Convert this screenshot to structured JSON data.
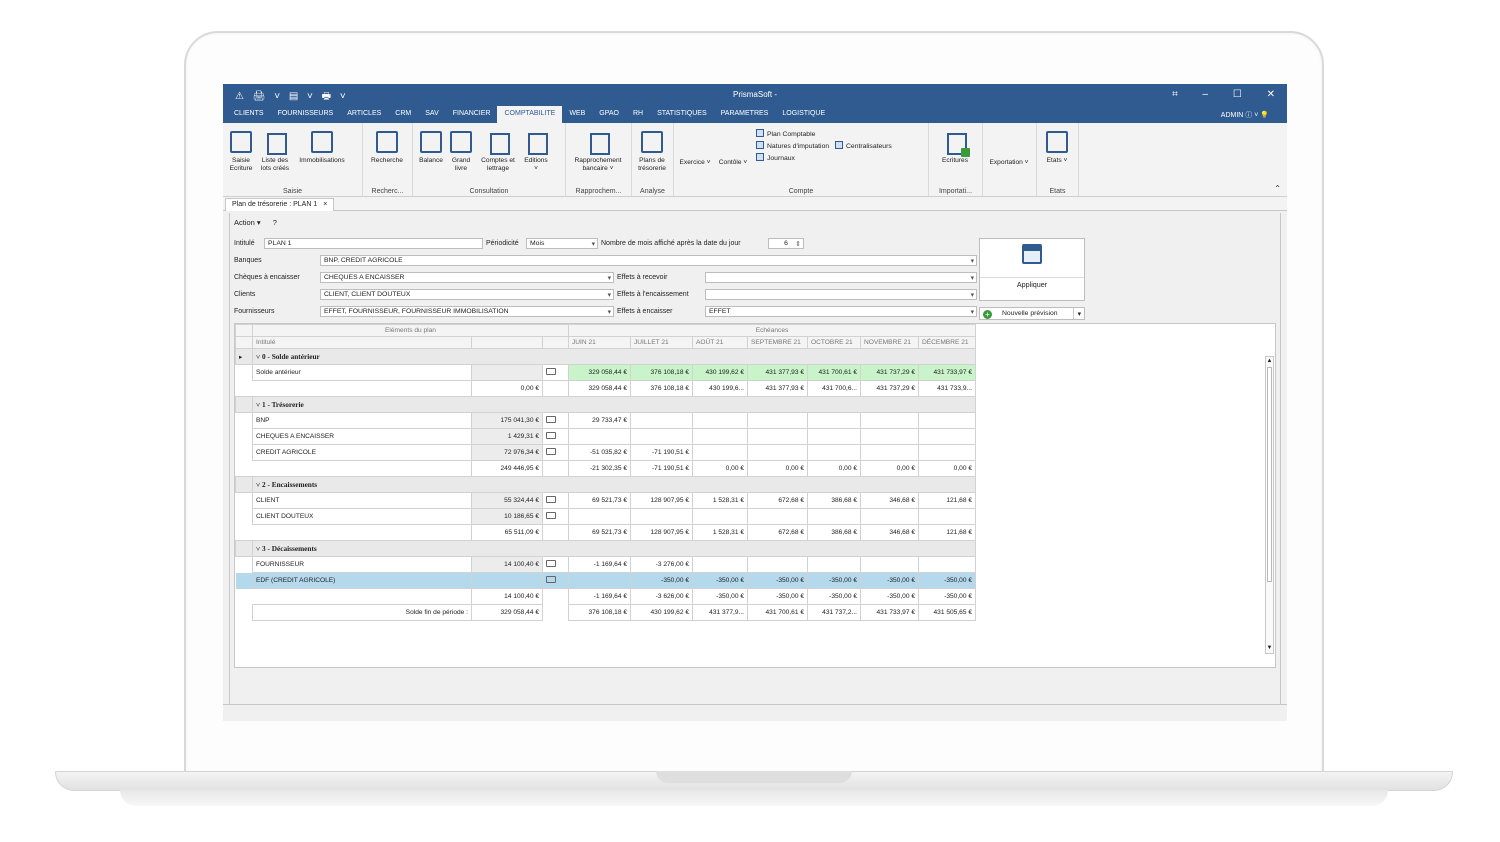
{
  "app": {
    "title": "PrismaSoft -",
    "quick_access": "⚠ 🖨 ˅ ▤ ˅ 🖶 ˅",
    "window_controls": [
      "⌗",
      "–",
      "☐",
      "✕"
    ],
    "user": "ADMIN ⓘ ˅ 💡"
  },
  "menu": [
    "CLIENTS",
    "FOURNISSEURS",
    "ARTICLES",
    "CRM",
    "SAV",
    "FINANCIER",
    "COMPTABILITE",
    "WEB",
    "GPAO",
    "RH",
    "STATISTIQUES",
    "PARAMETRES",
    "LOGISTIQUE"
  ],
  "menu_active": "COMPTABILITE",
  "ribbon": {
    "saisie": {
      "buttons": [
        "Saisie Ecriture",
        "Liste des lots créés",
        "Immobilisations"
      ],
      "group": "Saisie"
    },
    "recherche": {
      "buttons": [
        "Recherche"
      ],
      "group": "Recherc..."
    },
    "consultation": {
      "buttons": [
        "Balance",
        "Grand livre",
        "Comptes et lettrage",
        "Editions ˅"
      ],
      "group": "Consultation"
    },
    "rapprochement": {
      "buttons": [
        "Rapprochement bancaire ˅"
      ],
      "group": "Rapprochem..."
    },
    "analyse": {
      "buttons": [
        "Plans de trésorerie"
      ],
      "group": "Analyse"
    },
    "compte": {
      "buttons": [
        "Exercice ˅",
        "Contôle ˅"
      ],
      "list": [
        "Plan Comptable",
        "Natures d'imputation",
        "Journaux"
      ],
      "centralisateurs": "Centralisateurs",
      "group": "Compte"
    },
    "importation": {
      "buttons": [
        "Ecritures"
      ],
      "group": "Importati..."
    },
    "exportation": {
      "buttons": [
        "Exportation ˅"
      ],
      "group": ""
    },
    "etats": {
      "buttons": [
        "Etats ˅"
      ],
      "group": "Etats"
    }
  },
  "doc_tab": {
    "label": "Plan de trésorerie : PLAN 1",
    "close": "×"
  },
  "actions": {
    "action": "Action ▾",
    "help": "?"
  },
  "form": {
    "intitule_label": "Intitulé",
    "intitule_value": "PLAN 1",
    "periodicite_label": "Périodicité",
    "periodicite_value": "Mois",
    "nb_mois_label": "Nombre de mois affiché après la date du jour",
    "nb_mois_value": "6",
    "banques_label": "Banques",
    "banques_value": "BNP, CREDIT AGRICOLE",
    "cheques_label": "Chèques à encaisser",
    "cheques_value": "CHEQUES A ENCAISSER",
    "clients_label": "Clients",
    "clients_value": "CLIENT, CLIENT DOUTEUX",
    "fournisseurs_label": "Fournisseurs",
    "fournisseurs_value": "EFFET, FOURNISSEUR, FOURNISSEUR IMMOBILISATION",
    "effets_recevoir_label": "Effets à recevoir",
    "effets_recevoir_value": "",
    "effets_encaissement_label": "Effets à l'encaissement",
    "effets_encaissement_value": "",
    "effets_encaisser_label": "Effets à encaisser",
    "effets_encaisser_value": "EFFET",
    "appliquer": "Appliquer",
    "nouvelle_prevision": "Nouvelle prévision"
  },
  "grid": {
    "group_plan": "Eléments du plan",
    "group_echeances": "Echéances",
    "col_intitule": "Intitulé",
    "months": [
      "JUIN 21",
      "JUILLET 21",
      "AOÛT 21",
      "SEPTEMBRE 21",
      "OCTOBRE 21",
      "NOVEMBRE 21",
      "DÉCEMBRE 21"
    ],
    "sections": [
      {
        "title": "0 - Solde antérieur",
        "rows": [
          {
            "label": "Solde antérieur",
            "amount": "",
            "green": true,
            "values": [
              "329 058,44 €",
              "376 108,18 €",
              "430 199,62 €",
              "431 377,93 €",
              "431 700,61 €",
              "431 737,29 €",
              "431 733,97 €"
            ]
          }
        ],
        "total": {
          "amount": "0,00 €",
          "values": [
            "329 058,44 €",
            "376 108,18 €",
            "430 199,6...",
            "431 377,93 €",
            "431 700,6...",
            "431 737,29 €",
            "431 733,9..."
          ]
        }
      },
      {
        "title": "1 - Trésorerie",
        "rows": [
          {
            "label": "BNP",
            "amount": "175 041,30 €",
            "values": [
              "29 733,47 €",
              "",
              "",
              "",
              "",
              "",
              ""
            ]
          },
          {
            "label": "CHEQUES A ENCAISSER",
            "amount": "1 429,31 €",
            "values": [
              "",
              "",
              "",
              "",
              "",
              "",
              ""
            ]
          },
          {
            "label": "CREDIT AGRICOLE",
            "amount": "72 976,34 €",
            "values": [
              "-51 035,82 €",
              "-71 190,51 €",
              "",
              "",
              "",
              "",
              ""
            ]
          }
        ],
        "total": {
          "amount": "249 446,95 €",
          "values": [
            "-21 302,35 €",
            "-71 190,51 €",
            "0,00 €",
            "0,00 €",
            "0,00 €",
            "0,00 €",
            "0,00 €"
          ]
        }
      },
      {
        "title": "2 - Encaissements",
        "rows": [
          {
            "label": "CLIENT",
            "amount": "55 324,44 €",
            "values": [
              "69 521,73 €",
              "128 907,95 €",
              "1 528,31 €",
              "672,68 €",
              "386,68 €",
              "346,68 €",
              "121,68 €"
            ]
          },
          {
            "label": "CLIENT DOUTEUX",
            "amount": "10 186,65 €",
            "values": [
              "",
              "",
              "",
              "",
              "",
              "",
              ""
            ]
          }
        ],
        "total": {
          "amount": "65 511,09 €",
          "values": [
            "69 521,73 €",
            "128 907,95 €",
            "1 528,31 €",
            "672,68 €",
            "386,68 €",
            "346,68 €",
            "121,68 €"
          ]
        }
      },
      {
        "title": "3 - Décaissements",
        "rows": [
          {
            "label": "FOURNISSEUR",
            "amount": "14 100,40 €",
            "values": [
              "-1 169,64 €",
              "-3 276,00 €",
              "",
              "",
              "",
              "",
              ""
            ]
          },
          {
            "label": "EDF (CREDIT AGRICOLE)",
            "amount": "",
            "blue": true,
            "values": [
              "",
              "-350,00 €",
              "-350,00 €",
              "-350,00 €",
              "-350,00 €",
              "-350,00 €",
              "-350,00 €"
            ]
          }
        ],
        "total": {
          "amount": "14 100,40 €",
          "values": [
            "-1 169,64 €",
            "-3 626,00 €",
            "-350,00 €",
            "-350,00 €",
            "-350,00 €",
            "-350,00 €",
            "-350,00 €"
          ]
        }
      }
    ],
    "footer": {
      "label": "Solde fin de période :",
      "amount": "329 058,44 €",
      "values": [
        "376 108,18 €",
        "430 199,62 €",
        "431 377,9...",
        "431 700,61 €",
        "431 737,2...",
        "431 733,97 €",
        "431 505,65 €"
      ]
    }
  }
}
